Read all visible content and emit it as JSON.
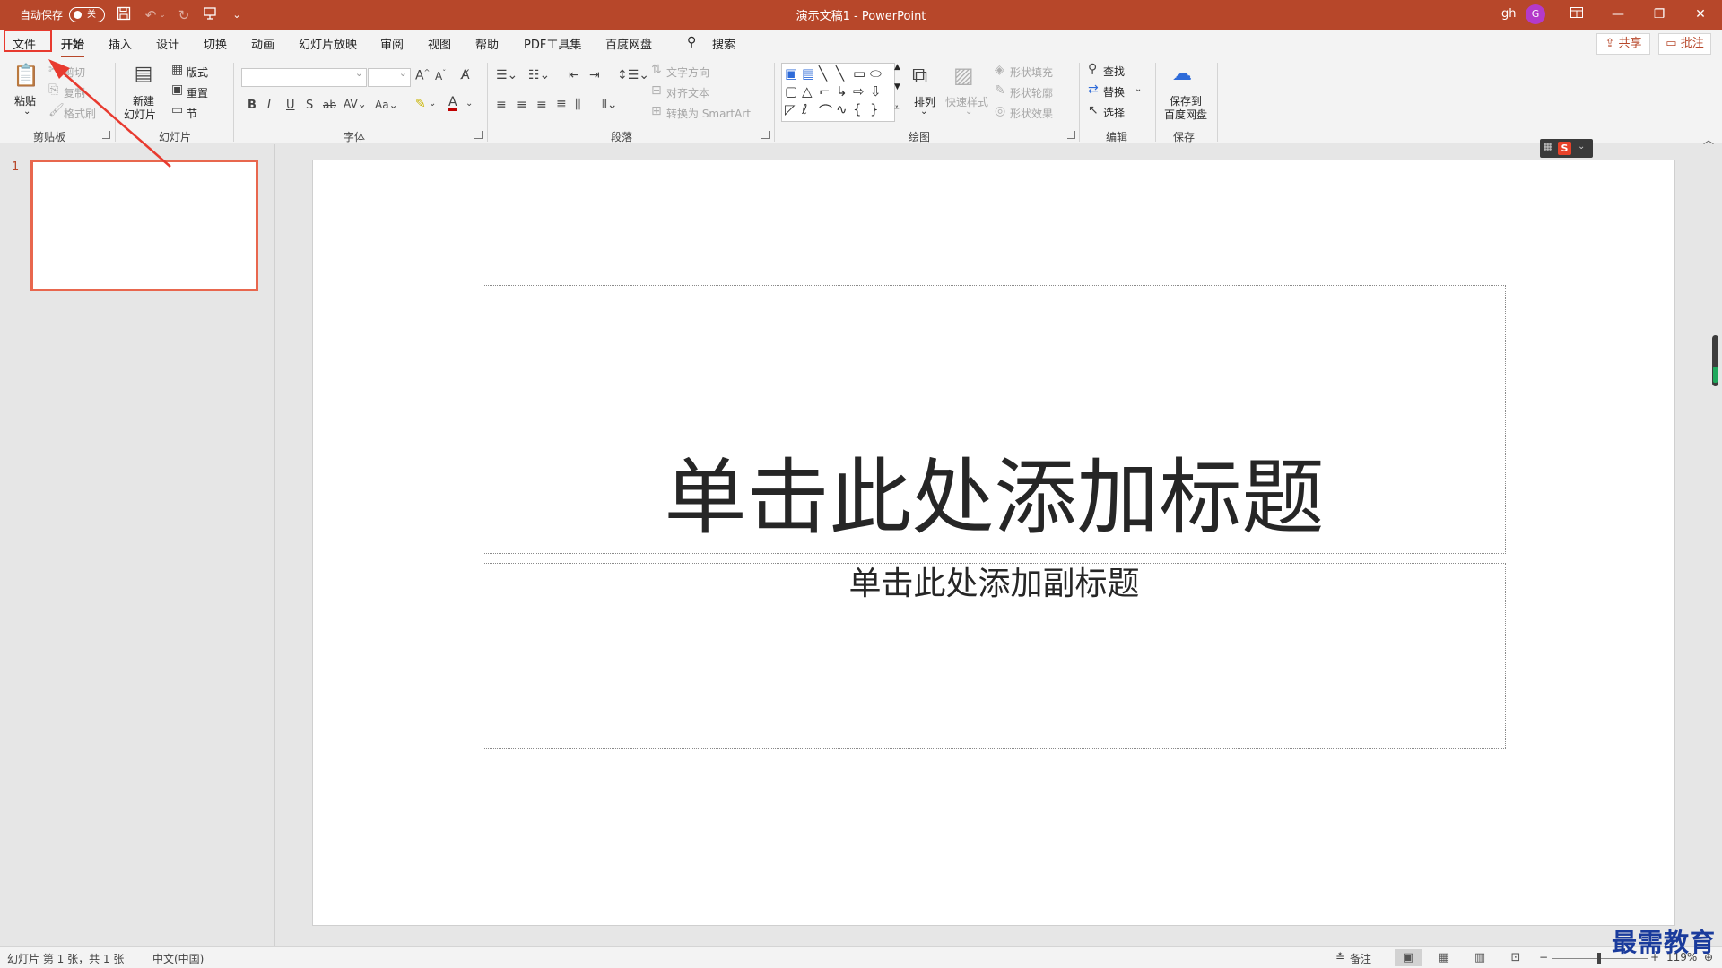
{
  "titlebar": {
    "autosave_label": "自动保存",
    "autosave_state": "关",
    "doc_title": "演示文稿1 - PowerPoint",
    "user_name": "gh",
    "avatar_initial": "G",
    "brand_color": "#b7472a"
  },
  "tabs": [
    {
      "label": "文件"
    },
    {
      "label": "开始",
      "active": true
    },
    {
      "label": "插入"
    },
    {
      "label": "设计"
    },
    {
      "label": "切换"
    },
    {
      "label": "动画"
    },
    {
      "label": "幻灯片放映"
    },
    {
      "label": "审阅"
    },
    {
      "label": "视图"
    },
    {
      "label": "帮助"
    },
    {
      "label": "PDF工具集"
    },
    {
      "label": "百度网盘"
    }
  ],
  "search": {
    "label": "搜索"
  },
  "share_label": "共享",
  "comment_label": "批注",
  "ribbon": {
    "clipboard": {
      "paste": "粘贴",
      "cut": "剪切",
      "copy": "复制",
      "format_painter": "格式刷",
      "label": "剪贴板"
    },
    "slides": {
      "new_slide_1": "新建",
      "new_slide_2": "幻灯片",
      "layout": "版式",
      "reset": "重置",
      "section": "节",
      "label": "幻灯片"
    },
    "font": {
      "label": "字体"
    },
    "paragraph": {
      "text_direction": "文字方向",
      "align_text": "对齐文本",
      "smartart": "转换为 SmartArt",
      "label": "段落"
    },
    "drawing": {
      "arrange": "排列",
      "quick_styles": "快速样式",
      "shape_fill": "形状填充",
      "shape_outline": "形状轮廓",
      "shape_effects": "形状效果",
      "label": "绘图"
    },
    "editing": {
      "find": "查找",
      "replace": "替换",
      "select": "选择",
      "label": "编辑"
    },
    "save": {
      "save_to_1": "保存到",
      "save_to_2": "百度网盘",
      "label": "保存"
    }
  },
  "thumbnail": {
    "number": "1"
  },
  "slide": {
    "title_placeholder": "单击此处添加标题",
    "subtitle_placeholder": "单击此处添加副标题"
  },
  "statusbar": {
    "slide_info": "幻灯片 第 1 张，共 1 张",
    "language": "中文(中国)",
    "notes": "备注",
    "zoom_level": "119%"
  },
  "watermark": "最需教育"
}
